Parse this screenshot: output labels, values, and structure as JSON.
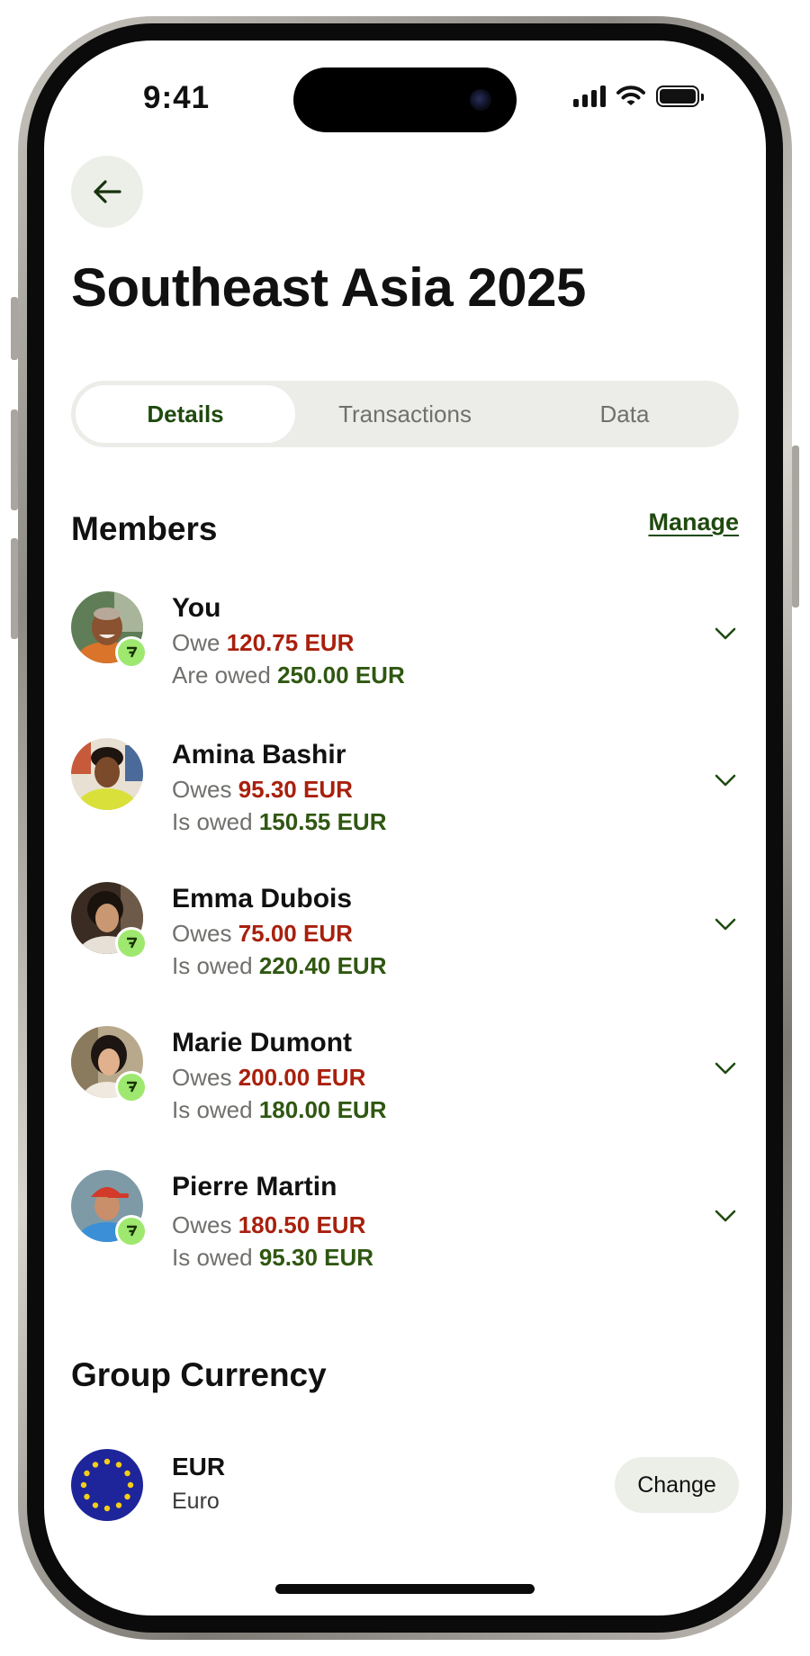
{
  "status_bar": {
    "time": "9:41"
  },
  "header": {
    "title": "Southeast Asia 2025"
  },
  "tabs": [
    {
      "label": "Details",
      "active": true
    },
    {
      "label": "Transactions",
      "active": false
    },
    {
      "label": "Data",
      "active": false
    }
  ],
  "members_section": {
    "title": "Members",
    "manage_label": "Manage",
    "members": [
      {
        "name": "You",
        "owe_label": "Owe",
        "owe_amount": "120.75 EUR",
        "owed_label": "Are owed",
        "owed_amount": "250.00 EUR",
        "has_badge": true
      },
      {
        "name": "Amina Bashir",
        "owe_label": "Owes",
        "owe_amount": "95.30 EUR",
        "owed_label": "Is owed",
        "owed_amount": "150.55 EUR",
        "has_badge": false
      },
      {
        "name": "Emma Dubois",
        "owe_label": "Owes",
        "owe_amount": "75.00 EUR",
        "owed_label": "Is owed",
        "owed_amount": "220.40 EUR",
        "has_badge": true
      },
      {
        "name": "Marie Dumont",
        "owe_label": "Owes",
        "owe_amount": "200.00 EUR",
        "owed_label": "Is owed",
        "owed_amount": "180.00 EUR",
        "has_badge": true
      },
      {
        "name": "Pierre Martin",
        "owe_label": "Owes",
        "owe_amount": "180.50 EUR",
        "owed_label": "Is owed",
        "owed_amount": "95.30 EUR",
        "has_badge": true
      }
    ]
  },
  "currency_section": {
    "title": "Group Currency",
    "code": "EUR",
    "name": "Euro",
    "change_label": "Change"
  },
  "colors": {
    "accent_green": "#1f4a0f",
    "positive": "#2f5711",
    "negative": "#a8200d",
    "badge": "#9fe870",
    "surface": "#eceee8"
  },
  "icons": {
    "back": "arrow-left-icon",
    "expand": "chevron-down-icon",
    "badge": "wise-logo-icon",
    "currency_flag": "eu-flag-icon"
  }
}
